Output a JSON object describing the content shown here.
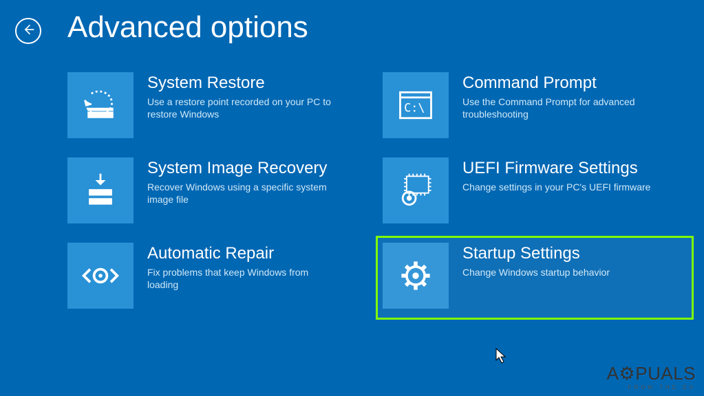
{
  "page": {
    "title": "Advanced options"
  },
  "options": {
    "system_restore": {
      "title": "System Restore",
      "desc": "Use a restore point recorded on your PC to restore Windows"
    },
    "system_image_recovery": {
      "title": "System Image Recovery",
      "desc": "Recover Windows using a specific system image file"
    },
    "automatic_repair": {
      "title": "Automatic Repair",
      "desc": "Fix problems that keep Windows from loading"
    },
    "command_prompt": {
      "title": "Command Prompt",
      "desc": "Use the Command Prompt for advanced troubleshooting"
    },
    "uefi_firmware": {
      "title": "UEFI Firmware Settings",
      "desc": "Change settings in your PC's UEFI firmware"
    },
    "startup_settings": {
      "title": "Startup Settings",
      "desc": "Change Windows startup behavior"
    }
  },
  "watermark": {
    "main": "APPUALS",
    "sub": "FROM THE EX"
  }
}
